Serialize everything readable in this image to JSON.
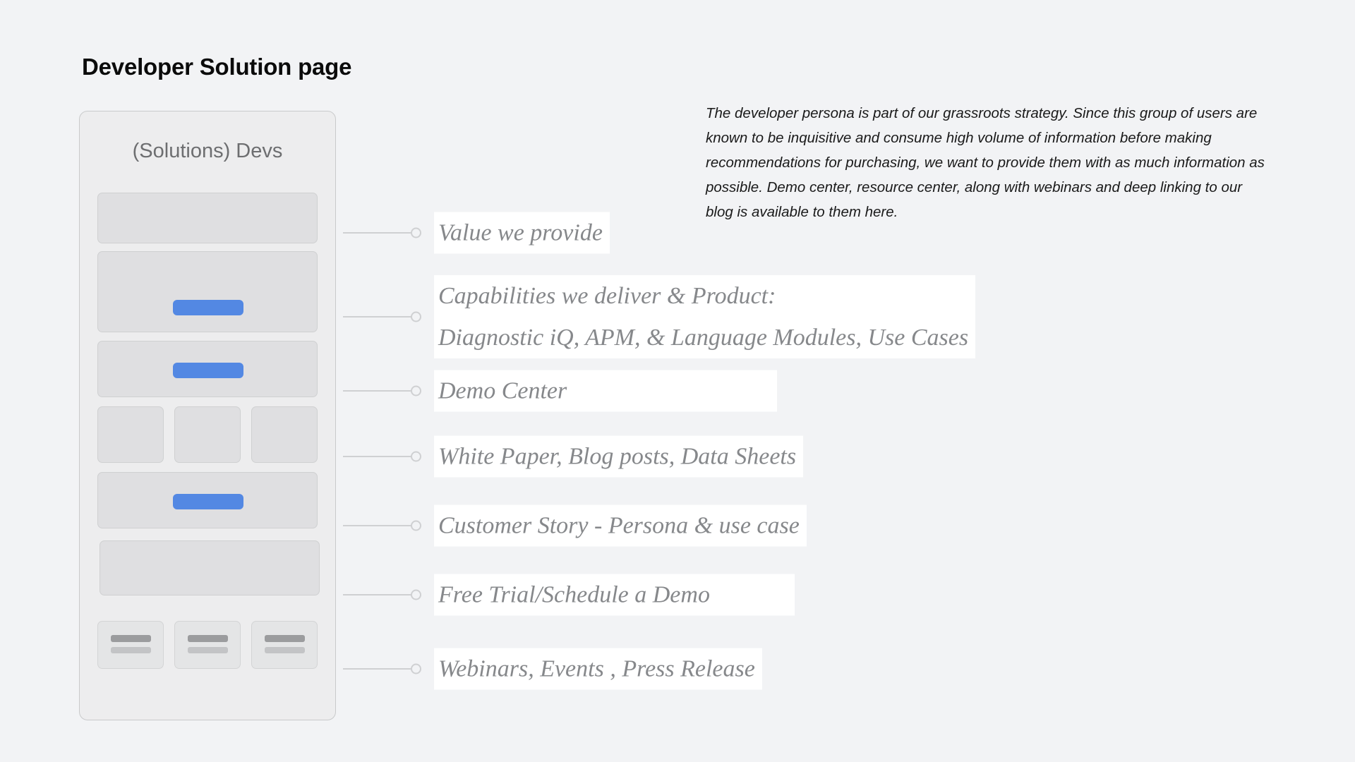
{
  "page": {
    "title": "Developer Solution page",
    "background_color": "#f2f3f5"
  },
  "description": {
    "text": "The developer persona is part of our grassroots strategy. Since this group of users are known to be inquisitive and consume high volume of information before making recommendations for purchasing, we want to provide them with as much information as possible. Demo center, resource center, along with webinars and deep linking to our blog is available to them here."
  },
  "wireframe": {
    "header": "(Solutions) Devs",
    "accent_color": "#5388e3",
    "card_fill": "#dfdfe1",
    "card_border": "#cfd0d1",
    "panel_fill": "#ededee",
    "panel_border": "#c9cacb",
    "rows": [
      {
        "name": "hero-banner",
        "has_button": false
      },
      {
        "name": "value-section",
        "has_button": true
      },
      {
        "name": "demo-section",
        "has_button": true
      },
      {
        "name": "resource-tiles",
        "has_button": false,
        "tiles": 3
      },
      {
        "name": "customer-story",
        "has_button": true
      },
      {
        "name": "free-trial",
        "has_button": false
      },
      {
        "name": "footer-tiles",
        "has_button": false,
        "tiles": 3
      }
    ]
  },
  "callouts": [
    {
      "id": "value-we-provide",
      "label": "Value we provide"
    },
    {
      "id": "capabilities",
      "label_line1": "Capabilities we deliver & Product:",
      "label_line2": "Diagnostic iQ, APM, & Language Modules, Use Cases"
    },
    {
      "id": "demo-center",
      "label": "Demo Center"
    },
    {
      "id": "resources",
      "label": "White Paper, Blog posts, Data Sheets"
    },
    {
      "id": "customer-story",
      "label": "Customer Story - Persona & use case"
    },
    {
      "id": "free-trial",
      "label": "Free Trial/Schedule a Demo"
    },
    {
      "id": "webinars",
      "label": "Webinars, Events , Press Release"
    }
  ]
}
